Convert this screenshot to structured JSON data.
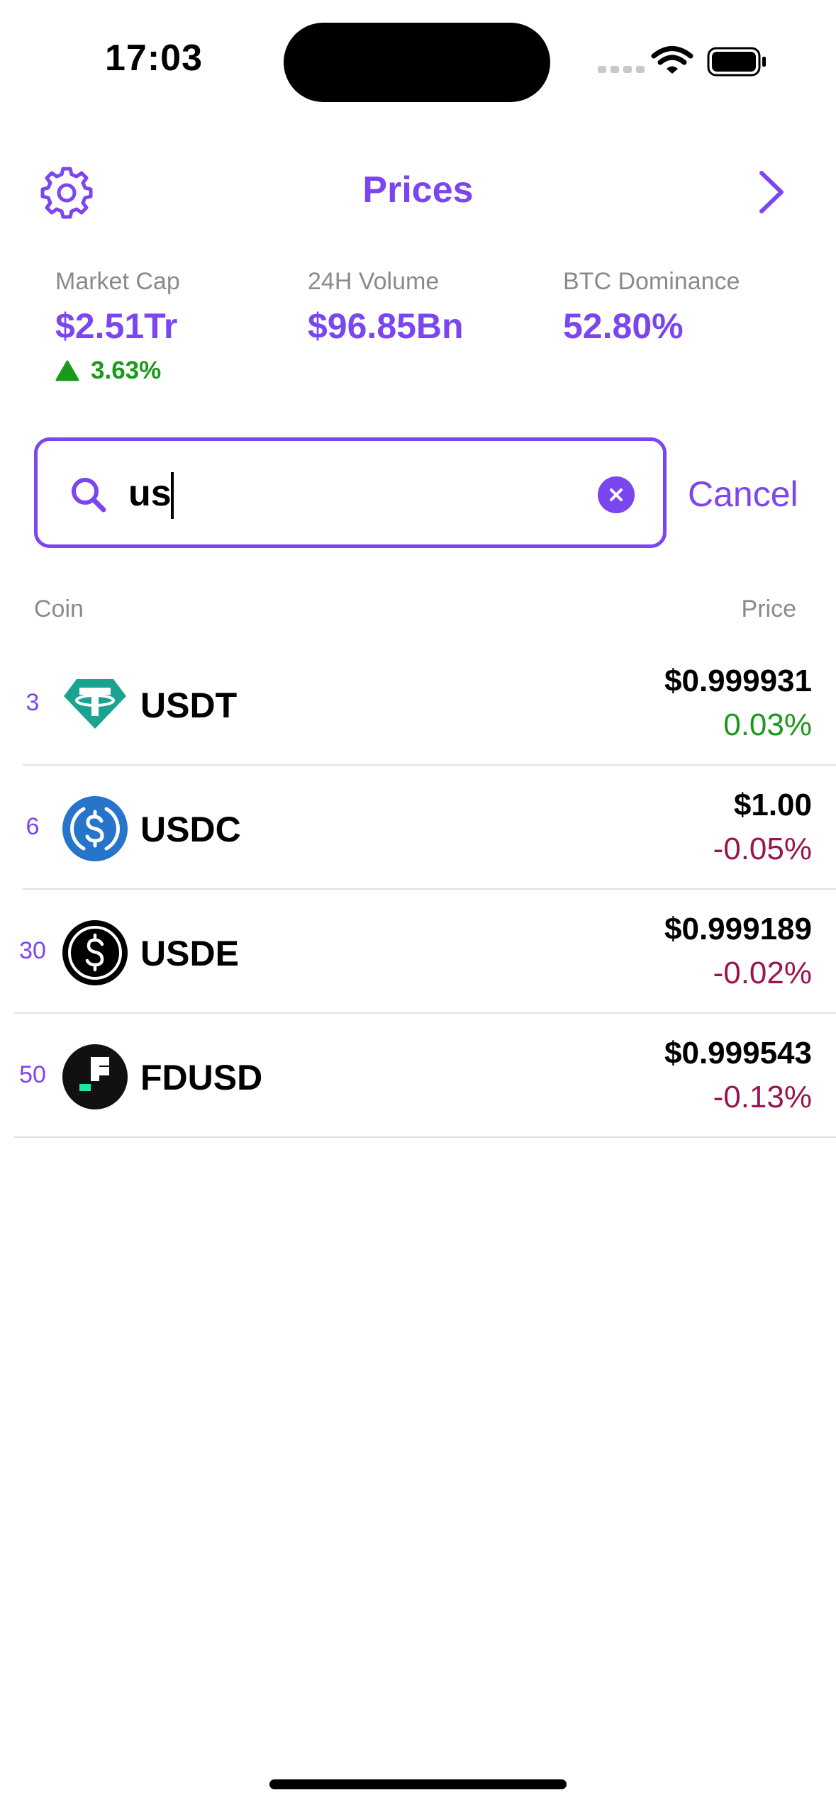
{
  "status_bar": {
    "time": "17:03"
  },
  "header": {
    "title": "Prices",
    "settings_icon": "gear-icon",
    "forward_icon": "chevron-right-icon"
  },
  "stats": {
    "market_cap": {
      "label": "Market Cap",
      "value": "$2.51Tr",
      "change": "3.63%",
      "change_direction": "up"
    },
    "volume_24h": {
      "label": "24H Volume",
      "value": "$96.85Bn"
    },
    "btc_dominance": {
      "label": "BTC Dominance",
      "value": "52.80%"
    }
  },
  "search": {
    "value": "us",
    "search_icon": "magnifier-icon",
    "clear_icon": "clear-circle-icon",
    "cancel_label": "Cancel"
  },
  "list": {
    "columns": {
      "coin": "Coin",
      "price": "Price"
    },
    "rows": [
      {
        "rank": "3",
        "symbol": "USDT",
        "price": "$0.999931",
        "change": "0.03%",
        "direction": "up",
        "icon": "tether-logo"
      },
      {
        "rank": "6",
        "symbol": "USDC",
        "price": "$1.00",
        "change": "-0.05%",
        "direction": "down",
        "icon": "usdc-logo"
      },
      {
        "rank": "30",
        "symbol": "USDE",
        "price": "$0.999189",
        "change": "-0.02%",
        "direction": "down",
        "icon": "usde-logo"
      },
      {
        "rank": "50",
        "symbol": "FDUSD",
        "price": "$0.999543",
        "change": "-0.13%",
        "direction": "down",
        "icon": "fdusd-logo"
      }
    ]
  },
  "colors": {
    "accent": "#7b45f0",
    "positive": "#1a9a1a",
    "negative": "#9a1550",
    "muted": "#8a8a8e"
  }
}
